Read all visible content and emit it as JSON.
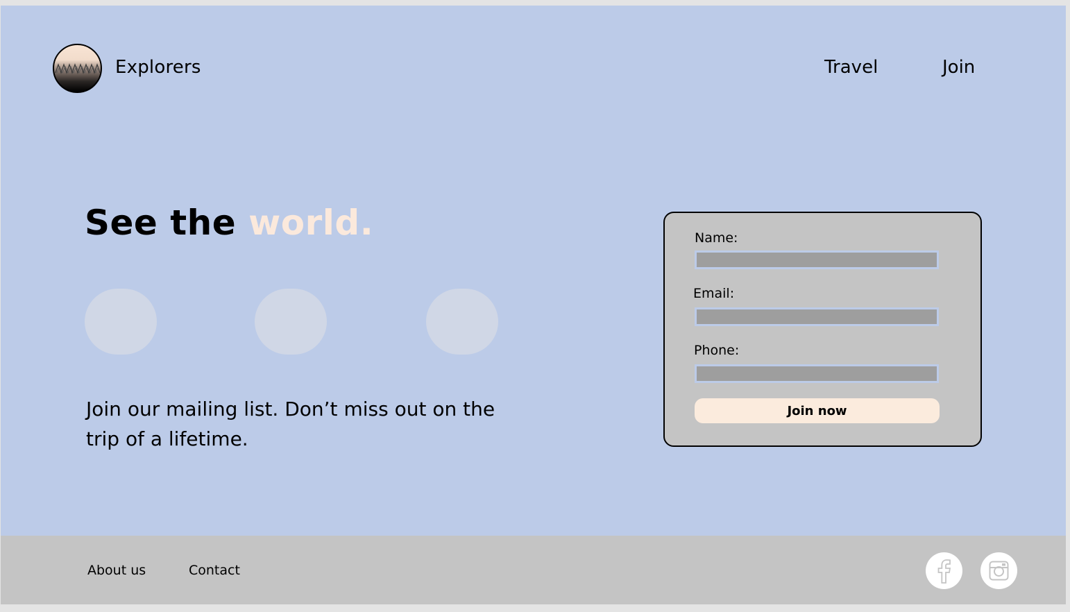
{
  "header": {
    "brand": "Explorers",
    "nav": [
      {
        "label": "Travel"
      },
      {
        "label": "Join"
      }
    ]
  },
  "hero": {
    "title_prefix": "See the ",
    "title_accent": "world.",
    "tagline": "Join our mailing list. Don’t miss out on the trip of a lifetime."
  },
  "signup": {
    "fields": [
      {
        "label": "Name:",
        "value": ""
      },
      {
        "label": "Email:",
        "value": ""
      },
      {
        "label": "Phone:",
        "value": ""
      }
    ],
    "submit_label": "Join now"
  },
  "footer": {
    "links": [
      {
        "label": "About us"
      },
      {
        "label": "Contact"
      }
    ],
    "social_icons": [
      "facebook-icon",
      "instagram-icon"
    ]
  },
  "colors": {
    "page_background": "#bccbe8",
    "accent": "#fbe9dc",
    "panel": "#c4c4c4",
    "input_fill": "#9e9e9e",
    "button_fill": "#fbebdd"
  }
}
